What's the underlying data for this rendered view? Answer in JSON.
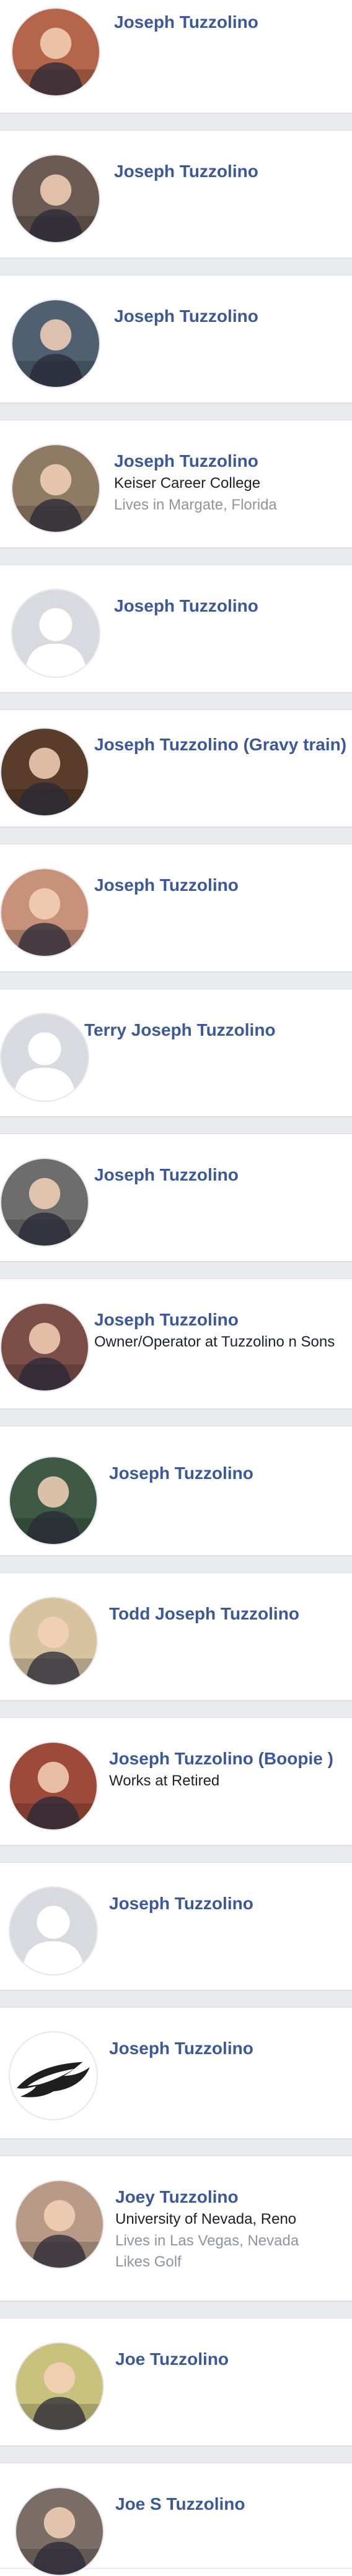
{
  "results": [
    {
      "name": "Joseph Tuzzolino",
      "lines": [],
      "muted": [],
      "icon": "photo-avatar-icon",
      "bg": "#b5654a"
    },
    {
      "name": "Joseph Tuzzolino",
      "lines": [],
      "muted": [],
      "icon": "photo-avatar-icon",
      "bg": "#6b5b52"
    },
    {
      "name": "Joseph Tuzzolino",
      "lines": [],
      "muted": [],
      "icon": "photo-avatar-icon",
      "bg": "#4f6170"
    },
    {
      "name": "Joseph Tuzzolino",
      "lines": [
        "Keiser Career College"
      ],
      "muted": [
        "Lives in Margate, Florida"
      ],
      "icon": "photo-avatar-icon",
      "bg": "#8f7a63"
    },
    {
      "name": "Joseph Tuzzolino",
      "lines": [],
      "muted": [],
      "icon": "default-avatar-icon",
      "bg": "#d8dadf"
    },
    {
      "name": "Joseph Tuzzolino (Gravy train)",
      "lines": [],
      "muted": [],
      "icon": "photo-avatar-icon",
      "bg": "#5a3c2a"
    },
    {
      "name": "Joseph Tuzzolino",
      "lines": [],
      "muted": [],
      "icon": "photo-avatar-icon",
      "bg": "#c8927a"
    },
    {
      "name": "Terry Joseph Tuzzolino",
      "lines": [],
      "muted": [],
      "icon": "default-avatar-icon",
      "bg": "#d8dadf"
    },
    {
      "name": "Joseph Tuzzolino",
      "lines": [],
      "muted": [],
      "icon": "photo-avatar-icon",
      "bg": "#6d6d6d"
    },
    {
      "name": "Joseph Tuzzolino",
      "lines": [
        "Owner/Operator at Tuzzolino n Sons"
      ],
      "muted": [],
      "icon": "photo-avatar-icon",
      "bg": "#7c4e48"
    },
    {
      "name": "Joseph Tuzzolino",
      "lines": [],
      "muted": [],
      "icon": "photo-avatar-icon",
      "bg": "#3e5a44"
    },
    {
      "name": "Todd Joseph Tuzzolino",
      "lines": [],
      "muted": [],
      "icon": "photo-avatar-icon",
      "bg": "#d7c3a0"
    },
    {
      "name": "Joseph Tuzzolino (Boopie )",
      "lines": [
        "Works at Retired"
      ],
      "muted": [],
      "icon": "photo-avatar-icon",
      "bg": "#9d4a3a"
    },
    {
      "name": "Joseph Tuzzolino",
      "lines": [],
      "muted": [],
      "icon": "default-avatar-icon",
      "bg": "#d8dadf"
    },
    {
      "name": "Joseph Tuzzolino",
      "lines": [],
      "muted": [],
      "icon": "eagles-logo-icon",
      "bg": "#ffffff"
    },
    {
      "name": "Joey Tuzzolino",
      "lines": [
        "University of Nevada, Reno"
      ],
      "muted": [
        "Lives in Las Vegas, Nevada",
        "Likes Golf"
      ],
      "icon": "photo-avatar-icon",
      "bg": "#b89a86"
    },
    {
      "name": "Joe Tuzzolino",
      "lines": [],
      "muted": [],
      "icon": "photo-avatar-icon",
      "bg": "#c9c27e"
    },
    {
      "name": "Joe S Tuzzolino",
      "lines": [],
      "muted": [],
      "icon": "photo-avatar-icon",
      "bg": "#7a6e66"
    }
  ]
}
